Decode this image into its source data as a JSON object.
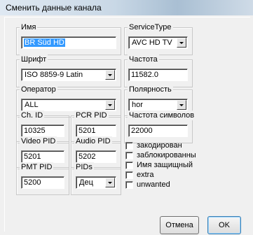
{
  "window": {
    "title": "Сменить данные канала"
  },
  "name": {
    "label": "Имя",
    "value": "BR Süd HD"
  },
  "service_type": {
    "label": "ServiceType",
    "value": "AVC HD TV"
  },
  "font": {
    "label": "Шрифт",
    "value": "ISO 8859-9 Latin"
  },
  "frequency": {
    "label": "Частота",
    "value": "11582.0"
  },
  "operator": {
    "label": "Оператор",
    "value": "ALL"
  },
  "polarity": {
    "label": "Полярность",
    "value": "hor"
  },
  "ch_id": {
    "label": "Ch. ID",
    "value": "10325"
  },
  "pcr_pid": {
    "label": "PCR PID",
    "value": "5201"
  },
  "symbol_rate": {
    "label": "Частота символов",
    "value": "22000"
  },
  "video_pid": {
    "label": "Video PID",
    "value": "5201"
  },
  "audio_pid": {
    "label": "Audio PID",
    "value": "5202"
  },
  "pmt_pid": {
    "label": "PMT PID",
    "value": "5200"
  },
  "pids": {
    "label": "PIDs",
    "value": "Дец"
  },
  "checkboxes": [
    {
      "label": "закодирован",
      "checked": false
    },
    {
      "label": "заблокированны",
      "checked": false
    },
    {
      "label": "Имя защищный",
      "checked": false
    },
    {
      "label": "extra",
      "checked": false
    },
    {
      "label": "unwanted",
      "checked": false
    }
  ],
  "buttons": {
    "cancel": "Отмена",
    "ok": "OK"
  }
}
